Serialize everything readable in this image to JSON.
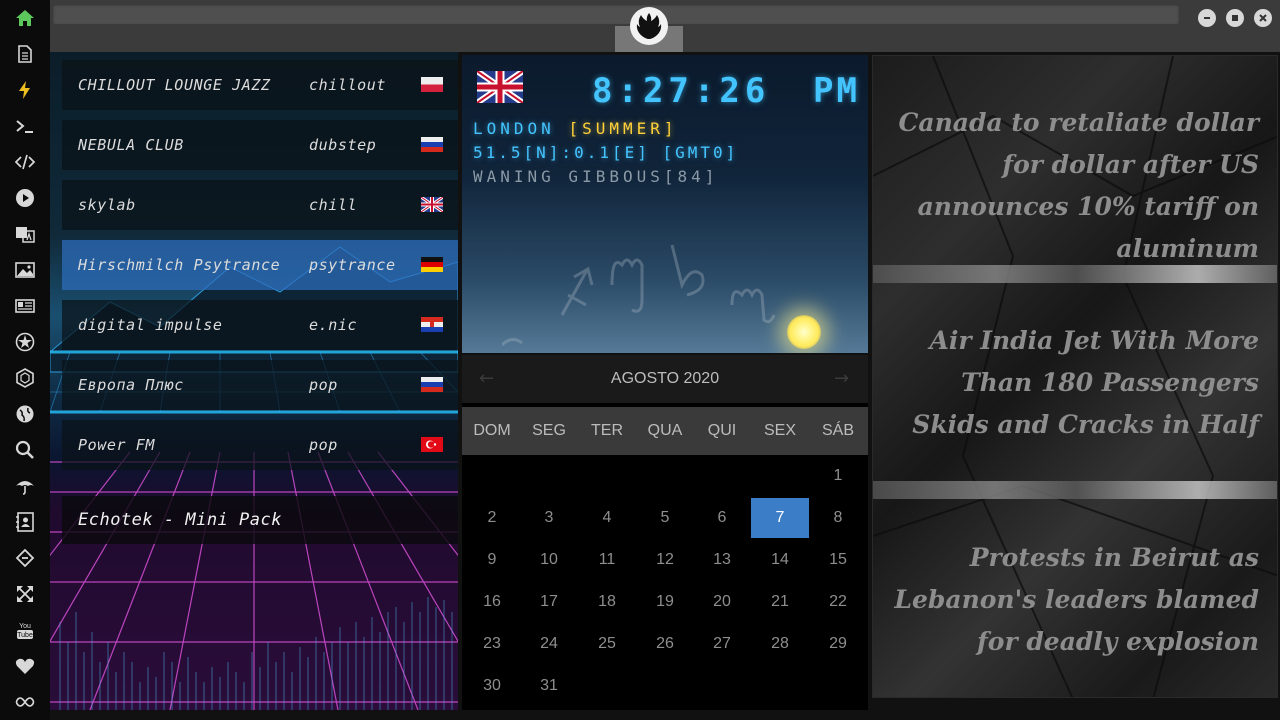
{
  "sidebar": {
    "icons": [
      "home-icon",
      "document-icon",
      "lightning-icon",
      "terminal-icon",
      "code-icon",
      "play-icon",
      "translate-icon",
      "image-icon",
      "news-icon",
      "rebel-icon",
      "hexagon-icon",
      "globe-icon",
      "search-icon",
      "umbrella-icon",
      "contact-icon",
      "tag-icon",
      "expand-icon",
      "youtube-icon",
      "heart-icon",
      "infinity-icon"
    ],
    "youtube_label": "You Tube"
  },
  "colors": {
    "active_icon": "#5cc85c",
    "accent": "#3b7ec7",
    "lcd": "#44c4ff",
    "lcd_season": "#ffd23a"
  },
  "radio": {
    "stations": [
      {
        "name": "CHILLOUT LOUNGE JAZZ",
        "genre": "chillout",
        "flag": "pl"
      },
      {
        "name": "NEBULA CLUB",
        "genre": "dubstep",
        "flag": "ru"
      },
      {
        "name": "skylab",
        "genre": "chill",
        "flag": "gb"
      },
      {
        "name": "Hirschmilch Psytrance",
        "genre": "psytrance",
        "flag": "de"
      },
      {
        "name": "digital impulse",
        "genre": "e.nic",
        "flag": "hr"
      },
      {
        "name": "Европа Плюс",
        "genre": "pop",
        "flag": "ru"
      },
      {
        "name": "Power FM",
        "genre": "pop",
        "flag": "tr"
      }
    ],
    "now_playing": "Echotek - Mini Pack"
  },
  "clock": {
    "time": "8:27:26",
    "ampm": "PM",
    "city": "LONDON ",
    "season": "[SUMMER]",
    "coords": "51.5[N]:0.1[E] [GMT0]",
    "moon": "WANING GIBBOUS[84]"
  },
  "calendar": {
    "title": "AGOSTO 2020",
    "prev": "←",
    "next": "→",
    "weekdays": [
      "DOM",
      "SEG",
      "TER",
      "QUA",
      "QUI",
      "SEX",
      "SÁB"
    ],
    "days": [
      "1",
      "2",
      "3",
      "4",
      "5",
      "6",
      "7",
      "8",
      "9",
      "10",
      "11",
      "12",
      "13",
      "14",
      "15",
      "16",
      "17",
      "18",
      "19",
      "20",
      "21",
      "22",
      "23",
      "24",
      "25",
      "26",
      "27",
      "28",
      "29",
      "30",
      "31"
    ],
    "today": "7"
  },
  "news": {
    "items": [
      "Canada to retaliate dollar for dollar after US announces 10% tariff on aluminum",
      "Air India Jet With More Than 180 Passengers Skids and Cracks in Half",
      "Protests in Beirut as Lebanon's leaders blamed for deadly explosion"
    ]
  }
}
